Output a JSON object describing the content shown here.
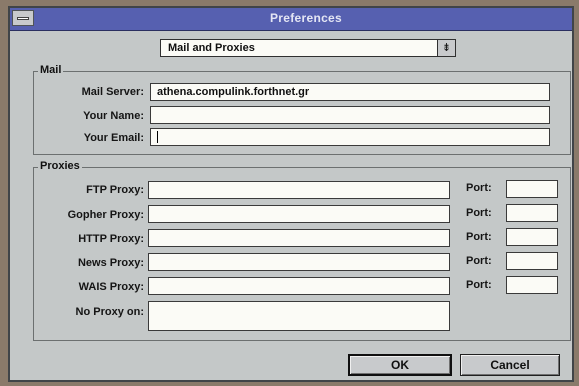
{
  "window": {
    "title": "Preferences"
  },
  "category": {
    "selected": "Mail and Proxies",
    "arrow_glyph": "⇟"
  },
  "mail": {
    "group_label": "Mail",
    "server_label": "Mail Server:",
    "server_value": "athena.compulink.forthnet.gr",
    "name_label": "Your Name:",
    "name_value": "",
    "email_label": "Your Email:",
    "email_value": ""
  },
  "proxies": {
    "group_label": "Proxies",
    "port_label": "Port:",
    "ftp_label": "FTP Proxy:",
    "gopher_label": "Gopher Proxy:",
    "http_label": "HTTP Proxy:",
    "news_label": "News Proxy:",
    "wais_label": "WAIS Proxy:",
    "noproxy_label": "No Proxy on:",
    "ftp_value": "",
    "gopher_value": "",
    "http_value": "",
    "news_value": "",
    "wais_value": "",
    "noproxy_value": "",
    "ftp_port": "",
    "gopher_port": "",
    "http_port": "",
    "news_port": "",
    "wais_port": ""
  },
  "buttons": {
    "ok": "OK",
    "cancel": "Cancel"
  },
  "colors": {
    "titlebar": "#5660b0",
    "dialog_bg": "#c4c8c8",
    "field_bg": "#fbfbf6"
  }
}
